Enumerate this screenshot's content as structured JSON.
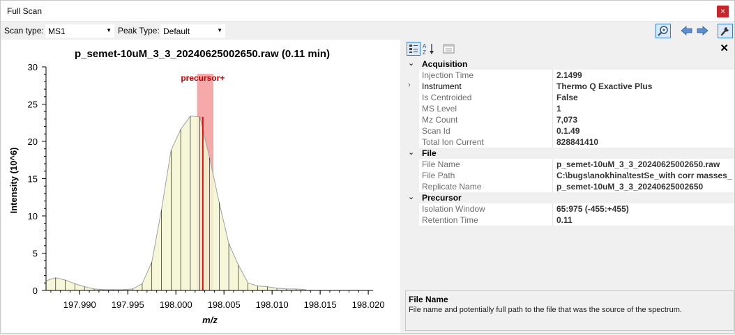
{
  "window": {
    "title": "Full Scan",
    "close_glyph": "×"
  },
  "toolbar": {
    "scan_type_label": "Scan type:",
    "scan_type_value": "MS1",
    "peak_type_label": "Peak Type:",
    "peak_type_value": "Default",
    "icons": [
      "zoom-spectrum-icon",
      "arrow-left-icon",
      "arrow-right-icon",
      "wrench-icon"
    ]
  },
  "chart": {
    "title": "p_semet-10uM_3_3_20240625002650.raw  (0.11 min)",
    "xlabel": "m/z",
    "ylabel": "Intensity (10^6)",
    "annotation": "precursor+",
    "colors": {
      "fill": "#f4f4d2",
      "outline": "#a0a0a0",
      "stick": "#000000",
      "highlight": "#f4a0a0",
      "precursor_stick": "#e01010",
      "annotation": "#c00000"
    }
  },
  "chart_data": {
    "type": "area",
    "title": "p_semet-10uM_3_3_20240625002650.raw  (0.11 min)",
    "xlabel": "m/z",
    "ylabel": "Intensity (10^6)",
    "xlim": [
      197.9865,
      198.0205
    ],
    "ylim": [
      0,
      30
    ],
    "xticks": [
      "197.990",
      "197.995",
      "198.000",
      "198.005",
      "198.010",
      "198.015",
      "198.020"
    ],
    "xtick_values": [
      197.99,
      197.995,
      198.0,
      198.005,
      198.01,
      198.015,
      198.02
    ],
    "yticks": [
      0,
      5,
      10,
      15,
      20,
      25,
      30
    ],
    "x": [
      197.9865,
      197.9875,
      197.9885,
      197.9895,
      197.9905,
      197.9915,
      197.9925,
      197.9935,
      197.9945,
      197.9955,
      197.9965,
      197.9975,
      197.9985,
      197.9995,
      198.0005,
      198.0015,
      198.0025,
      198.0035,
      198.0045,
      198.0055,
      198.0065,
      198.0075,
      198.0085,
      198.0095,
      198.0105,
      198.0115,
      198.0125,
      198.0135
    ],
    "y": [
      1.3,
      1.7,
      1.4,
      0.9,
      0.5,
      0.2,
      0.1,
      0.1,
      0.1,
      0.2,
      0.9,
      3.8,
      10.8,
      18.8,
      21.6,
      23.4,
      23.3,
      17.8,
      11.8,
      6.3,
      3.4,
      1.0,
      0.6,
      0.5,
      0.3,
      0.2,
      0.2,
      0.1
    ],
    "precursor": {
      "mz": 198.0028,
      "intensity": 23.3,
      "window": [
        198.0022,
        198.0039
      ],
      "label": "precursor+"
    },
    "grid": false,
    "legend": "none"
  },
  "properties": {
    "sort_icons": [
      "categorized-icon",
      "alphabetical-icon",
      "property-pages-icon"
    ],
    "close_glyph": "✕",
    "categories": [
      {
        "name": "Acquisition",
        "props": [
          {
            "name": "Injection Time",
            "value": "2.1499"
          },
          {
            "name": "Instrument",
            "value": "Thermo Q Exactive Plus",
            "expandable": true
          },
          {
            "name": "Is Centroided",
            "value": "False"
          },
          {
            "name": "MS Level",
            "value": "1"
          },
          {
            "name": "Mz Count",
            "value": "7,073"
          },
          {
            "name": "Scan Id",
            "value": "0.1.49"
          },
          {
            "name": "Total Ion Current",
            "value": "828841410"
          }
        ]
      },
      {
        "name": "File",
        "props": [
          {
            "name": "File Name",
            "value": "p_semet-10uM_3_3_20240625002650.raw"
          },
          {
            "name": "File Path",
            "value": "C:\\bugs\\anokhina\\testSe_with corr masses_"
          },
          {
            "name": "Replicate Name",
            "value": "p_semet-10uM_3_3_20240625002650"
          }
        ]
      },
      {
        "name": "Precursor",
        "props": [
          {
            "name": "Isolation Window",
            "value": "65:975 (-455:+455)"
          },
          {
            "name": "Retention Time",
            "value": "0.11"
          }
        ]
      }
    ]
  },
  "help": {
    "title": "File Name",
    "description": "File name and potentially full path to the file that was the source of the spectrum."
  }
}
